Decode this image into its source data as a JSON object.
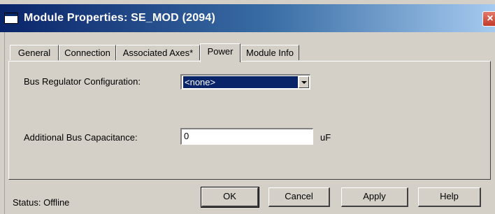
{
  "window": {
    "title": "Module Properties: SE_MOD (2094)",
    "close_glyph": "×"
  },
  "tabs": [
    {
      "label": "General"
    },
    {
      "label": "Connection"
    },
    {
      "label": "Associated Axes*"
    },
    {
      "label": "Power"
    },
    {
      "label": "Module Info"
    }
  ],
  "active_tab": "Power",
  "form": {
    "bus_regulator_label": "Bus Regulator Configuration:",
    "bus_regulator_value": "<none>",
    "bus_capacitance_label": "Additional Bus Capacitance:",
    "bus_capacitance_value": "0",
    "bus_capacitance_unit": "uF"
  },
  "status": {
    "text": "Status:  Offline"
  },
  "buttons": {
    "ok": "OK",
    "cancel": "Cancel",
    "apply": "Apply",
    "help": "Help"
  },
  "colors": {
    "titlebar_start": "#0a246a",
    "titlebar_end": "#a6caf0",
    "selection": "#0a246a",
    "face": "#d4d0c8"
  }
}
